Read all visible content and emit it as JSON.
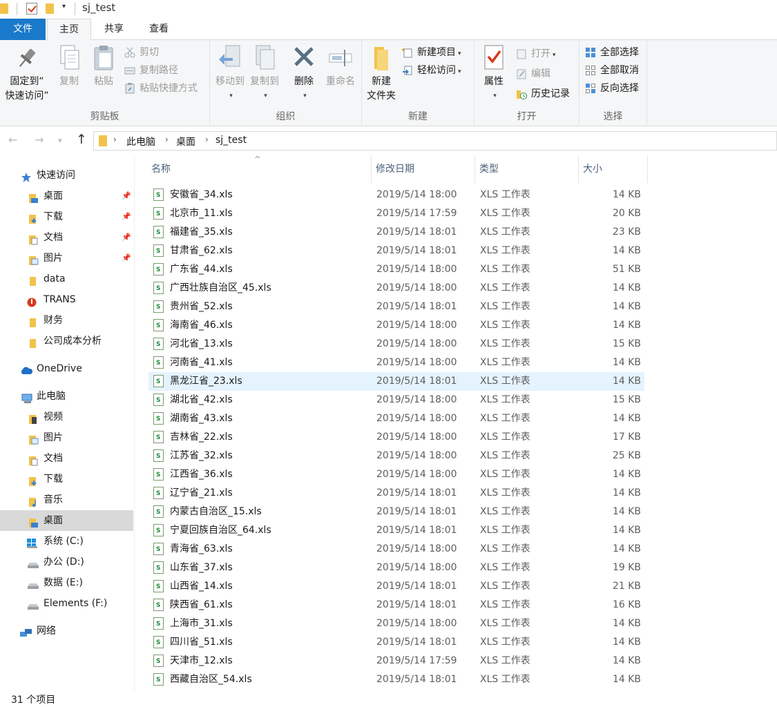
{
  "window": {
    "title": "sj_test"
  },
  "tabs": {
    "file": "文件",
    "home": "主页",
    "share": "共享",
    "view": "查看"
  },
  "ribbon": {
    "clipboard": {
      "pin_line1": "固定到“",
      "pin_line2": "快速访问”",
      "copy": "复制",
      "paste": "粘贴",
      "cut": "剪切",
      "copy_path": "复制路径",
      "paste_shortcut": "粘贴快捷方式",
      "group_name": "剪贴板"
    },
    "organize": {
      "move_to": "移动到",
      "copy_to": "复制到",
      "delete": "删除",
      "rename": "重命名",
      "group_name": "组织"
    },
    "new": {
      "new_folder_line1": "新建",
      "new_folder_line2": "文件夹",
      "new_item": "新建项目",
      "easy_access": "轻松访问",
      "group_name": "新建"
    },
    "open": {
      "properties": "属性",
      "open": "打开",
      "edit": "编辑",
      "history": "历史记录",
      "group_name": "打开"
    },
    "select": {
      "select_all": "全部选择",
      "select_none": "全部取消",
      "invert": "反向选择",
      "group_name": "选择"
    }
  },
  "address": {
    "crumbs": [
      "此电脑",
      "桌面",
      "sj_test"
    ]
  },
  "nav": {
    "quick_access": "快速访问",
    "qa_items": [
      "桌面",
      "下载",
      "文档",
      "图片",
      "data",
      "TRANS",
      "财务",
      "公司成本分析"
    ],
    "onedrive": "OneDrive",
    "this_pc": "此电脑",
    "pc_items": [
      "视频",
      "图片",
      "文档",
      "下载",
      "音乐",
      "桌面",
      "系统 (C:)",
      "办公 (D:)",
      "数据 (E:)",
      "Elements (F:)"
    ],
    "network": "网络"
  },
  "columns": {
    "name": "名称",
    "date": "修改日期",
    "type": "类型",
    "size": "大小"
  },
  "files": [
    {
      "name": "安徽省_34.xls",
      "date": "2019/5/14 18:00",
      "type": "XLS 工作表",
      "size": "14 KB"
    },
    {
      "name": "北京市_11.xls",
      "date": "2019/5/14 17:59",
      "type": "XLS 工作表",
      "size": "20 KB"
    },
    {
      "name": "福建省_35.xls",
      "date": "2019/5/14 18:01",
      "type": "XLS 工作表",
      "size": "23 KB"
    },
    {
      "name": "甘肃省_62.xls",
      "date": "2019/5/14 18:01",
      "type": "XLS 工作表",
      "size": "14 KB"
    },
    {
      "name": "广东省_44.xls",
      "date": "2019/5/14 18:00",
      "type": "XLS 工作表",
      "size": "51 KB"
    },
    {
      "name": "广西壮族自治区_45.xls",
      "date": "2019/5/14 18:00",
      "type": "XLS 工作表",
      "size": "14 KB"
    },
    {
      "name": "贵州省_52.xls",
      "date": "2019/5/14 18:01",
      "type": "XLS 工作表",
      "size": "14 KB"
    },
    {
      "name": "海南省_46.xls",
      "date": "2019/5/14 18:00",
      "type": "XLS 工作表",
      "size": "14 KB"
    },
    {
      "name": "河北省_13.xls",
      "date": "2019/5/14 18:00",
      "type": "XLS 工作表",
      "size": "15 KB"
    },
    {
      "name": "河南省_41.xls",
      "date": "2019/5/14 18:00",
      "type": "XLS 工作表",
      "size": "14 KB"
    },
    {
      "name": "黑龙江省_23.xls",
      "date": "2019/5/14 18:01",
      "type": "XLS 工作表",
      "size": "14 KB"
    },
    {
      "name": "湖北省_42.xls",
      "date": "2019/5/14 18:00",
      "type": "XLS 工作表",
      "size": "15 KB"
    },
    {
      "name": "湖南省_43.xls",
      "date": "2019/5/14 18:00",
      "type": "XLS 工作表",
      "size": "14 KB"
    },
    {
      "name": "吉林省_22.xls",
      "date": "2019/5/14 18:00",
      "type": "XLS 工作表",
      "size": "17 KB"
    },
    {
      "name": "江苏省_32.xls",
      "date": "2019/5/14 18:00",
      "type": "XLS 工作表",
      "size": "25 KB"
    },
    {
      "name": "江西省_36.xls",
      "date": "2019/5/14 18:00",
      "type": "XLS 工作表",
      "size": "14 KB"
    },
    {
      "name": "辽宁省_21.xls",
      "date": "2019/5/14 18:01",
      "type": "XLS 工作表",
      "size": "14 KB"
    },
    {
      "name": "内蒙古自治区_15.xls",
      "date": "2019/5/14 18:01",
      "type": "XLS 工作表",
      "size": "14 KB"
    },
    {
      "name": "宁夏回族自治区_64.xls",
      "date": "2019/5/14 18:01",
      "type": "XLS 工作表",
      "size": "14 KB"
    },
    {
      "name": "青海省_63.xls",
      "date": "2019/5/14 18:00",
      "type": "XLS 工作表",
      "size": "14 KB"
    },
    {
      "name": "山东省_37.xls",
      "date": "2019/5/14 18:00",
      "type": "XLS 工作表",
      "size": "19 KB"
    },
    {
      "name": "山西省_14.xls",
      "date": "2019/5/14 18:01",
      "type": "XLS 工作表",
      "size": "21 KB"
    },
    {
      "name": "陕西省_61.xls",
      "date": "2019/5/14 18:01",
      "type": "XLS 工作表",
      "size": "16 KB"
    },
    {
      "name": "上海市_31.xls",
      "date": "2019/5/14 18:00",
      "type": "XLS 工作表",
      "size": "14 KB"
    },
    {
      "name": "四川省_51.xls",
      "date": "2019/5/14 18:01",
      "type": "XLS 工作表",
      "size": "14 KB"
    },
    {
      "name": "天津市_12.xls",
      "date": "2019/5/14 17:59",
      "type": "XLS 工作表",
      "size": "14 KB"
    },
    {
      "name": "西藏自治区_54.xls",
      "date": "2019/5/14 18:01",
      "type": "XLS 工作表",
      "size": "14 KB"
    }
  ],
  "status": {
    "item_count": "31 个项目"
  },
  "colors": {
    "accent": "#1979ca",
    "folder": "#f1c34a",
    "selected_nav": "#d9d9d9",
    "hover_row": "#e5f3ff"
  }
}
